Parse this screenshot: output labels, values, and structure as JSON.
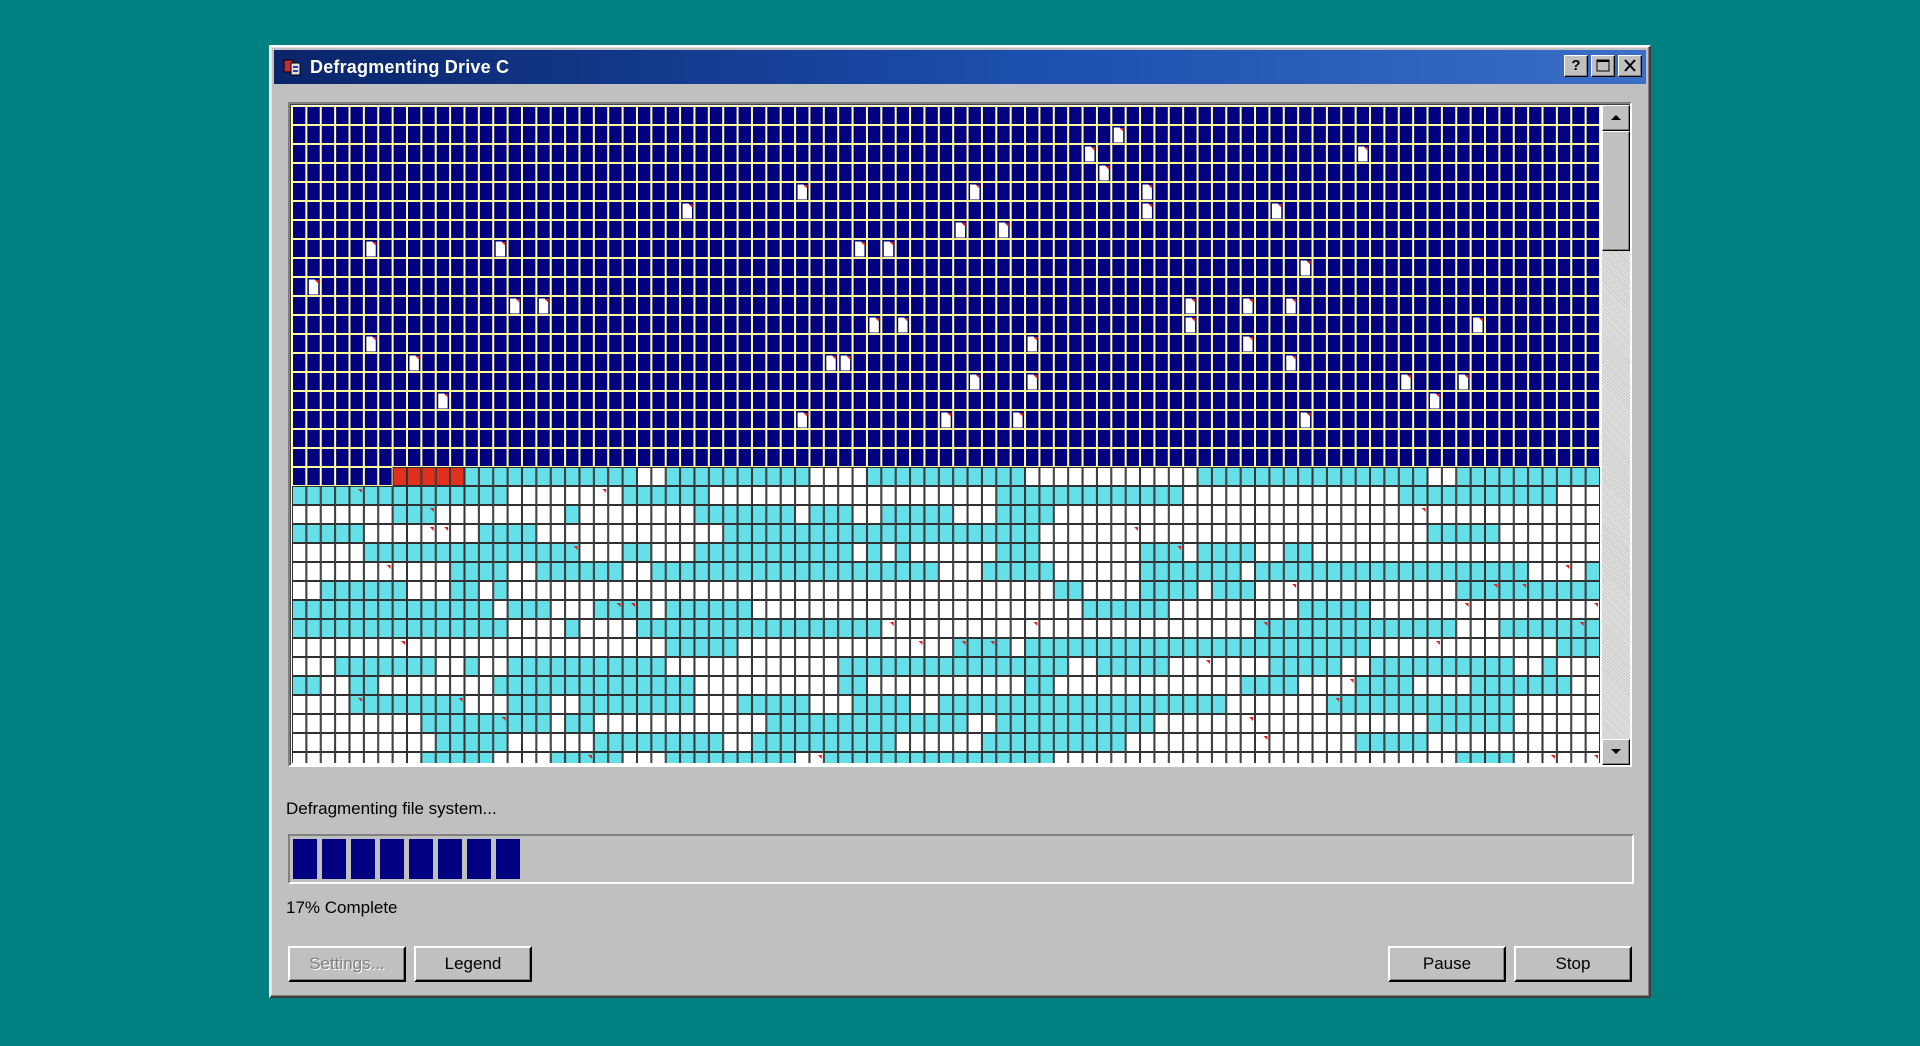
{
  "window": {
    "title": "Defragmenting Drive C",
    "controls": [
      "help",
      "maximize",
      "close"
    ]
  },
  "icons": {
    "title_icon": "defrag-app-icon",
    "file_cell_icon": "file-fragment-icon"
  },
  "colors": {
    "desktop": "#008080",
    "optimized_block": "#000080",
    "to_be_defragmented": "#66e0e8",
    "free_space": "#ffffff",
    "being_read": "#e03020",
    "grid_line_top": "#ffff99",
    "grid_line_bottom": "#303030"
  },
  "disk_map": {
    "columns": 91,
    "rows": 35,
    "optimized_full_rows": 19,
    "optimized_cells_in_row_19": 7,
    "reading_cells_in_row_19": [
      7,
      8,
      9,
      10,
      11
    ],
    "file_icons": [
      [
        1,
        57
      ],
      [
        2,
        55
      ],
      [
        2,
        74
      ],
      [
        3,
        56
      ],
      [
        4,
        35
      ],
      [
        4,
        47
      ],
      [
        4,
        59
      ],
      [
        5,
        27
      ],
      [
        5,
        59
      ],
      [
        5,
        68
      ],
      [
        6,
        46
      ],
      [
        6,
        49
      ],
      [
        7,
        5
      ],
      [
        7,
        14
      ],
      [
        7,
        39
      ],
      [
        7,
        41
      ],
      [
        8,
        70
      ],
      [
        9,
        1
      ],
      [
        10,
        15
      ],
      [
        10,
        17
      ],
      [
        10,
        62
      ],
      [
        10,
        66
      ],
      [
        10,
        69
      ],
      [
        11,
        40
      ],
      [
        11,
        42
      ],
      [
        11,
        62
      ],
      [
        11,
        82
      ],
      [
        12,
        5
      ],
      [
        12,
        51
      ],
      [
        12,
        66
      ],
      [
        13,
        8
      ],
      [
        13,
        37
      ],
      [
        13,
        38
      ],
      [
        13,
        69
      ],
      [
        14,
        47
      ],
      [
        14,
        51
      ],
      [
        14,
        77
      ],
      [
        14,
        81
      ],
      [
        15,
        10
      ],
      [
        15,
        79
      ],
      [
        16,
        35
      ],
      [
        16,
        45
      ],
      [
        16,
        50
      ],
      [
        16,
        70
      ]
    ],
    "scroll_position": 0
  },
  "status": {
    "text": "Defragmenting file system...",
    "progress_fraction": 0.17,
    "progress_text": "17% Complete"
  },
  "buttons": {
    "settings": "Settings...",
    "legend": "Legend",
    "pause": "Pause",
    "stop": "Stop"
  }
}
